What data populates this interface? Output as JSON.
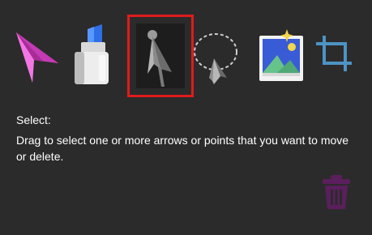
{
  "tools": [
    {
      "id": "draw",
      "icon": "paper-plane-pen-icon",
      "selected": false
    },
    {
      "id": "marker",
      "icon": "highlighter-marker-icon",
      "selected": false
    },
    {
      "id": "select",
      "icon": "select-arrow-icon",
      "selected": true
    },
    {
      "id": "lasso",
      "icon": "lasso-select-icon",
      "selected": false
    },
    {
      "id": "image",
      "icon": "image-icon",
      "selected": false
    },
    {
      "id": "crop",
      "icon": "crop-icon",
      "selected": false
    }
  ],
  "description": {
    "title": "Select:",
    "body": "Drag to select one or more arrows or points that you want to move or delete."
  },
  "delete": {
    "icon": "trash-icon"
  },
  "colors": {
    "background": "#2b2b2b",
    "selection_border": "#e01b1b",
    "text": "#ffffff",
    "trash": "#5a1f5c"
  }
}
